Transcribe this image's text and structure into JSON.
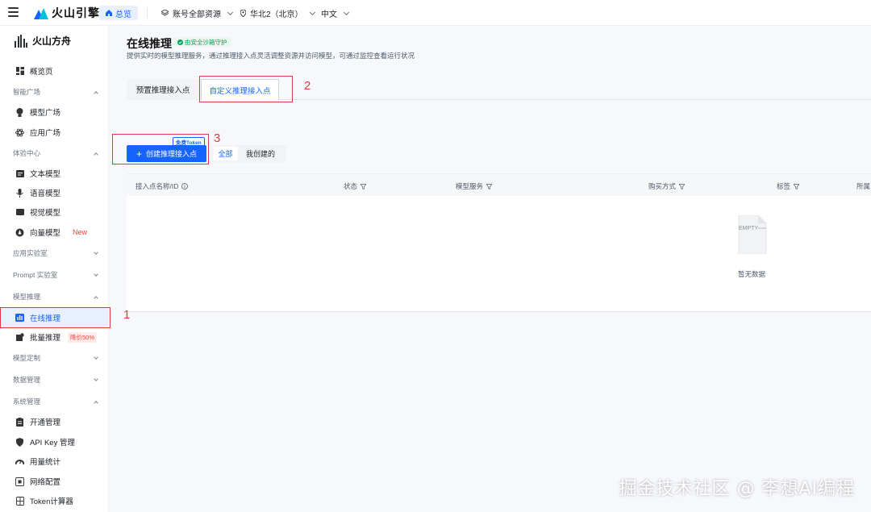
{
  "topbar": {
    "brand": "火山引擎",
    "home": "总览",
    "account_scope": "账号全部资源",
    "region": "华北2（北京）",
    "language": "中文"
  },
  "sidebar": {
    "brand": "火山方舟",
    "overview": "概览页",
    "groups": {
      "model_square": "智能广场",
      "experience": "体验中心",
      "app_lab": "应用实验室",
      "prompt_lab": "Prompt 实验室",
      "inference": "模型推理",
      "customization": "模型定制",
      "data": "数据管理",
      "system": "系统管理"
    },
    "items": {
      "model_plaza": "模型广场",
      "app_plaza": "应用广场",
      "text_model": "文本模型",
      "voice_model": "语音模型",
      "vision_model": "视觉模型",
      "vector_model": "向量模型",
      "vector_badge": "New",
      "online_inference": "在线推理",
      "batch_inference": "批量推理",
      "batch_badge": "降价50%",
      "activation": "开通管理",
      "apikey": "API Key 管理",
      "usage": "用量统计",
      "network": "网络配置",
      "token_calc": "Token计算器"
    }
  },
  "main": {
    "title": "在线推理",
    "safe_tag": "由安全沙箱守护",
    "description": "提供实时的模型推理服务，通过推理接入点灵活调整资源并访问模型，可通过监控查看运行状况",
    "tabs": [
      "预置推理接入点",
      "自定义推理接入点"
    ],
    "create_button": "创建推理接入点",
    "free_badge": "免费Token",
    "filter_all": "全部",
    "filter_mine": "我创建的",
    "columns": [
      "接入点名称/ID",
      "状态",
      "模型服务",
      "购买方式",
      "标签",
      "所属"
    ],
    "empty_icon_text": "EMPTY",
    "empty_text": "暂无数据"
  },
  "annotations": [
    "1",
    "2",
    "3"
  ],
  "watermark": "掘金技术社区 @ 李想AI编程",
  "colors": {
    "primary": "#1664ff",
    "annotation": "#e03a3a",
    "safe": "#00a35c"
  }
}
